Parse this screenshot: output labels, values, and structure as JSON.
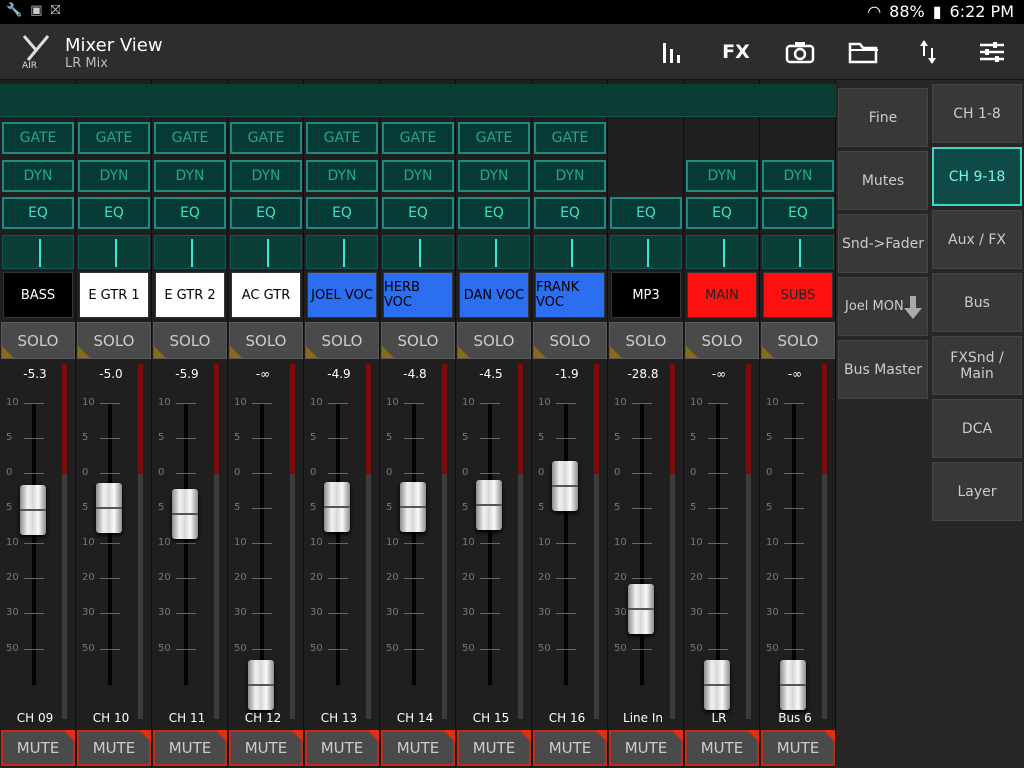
{
  "status": {
    "battery": "88%",
    "time": "6:22 PM"
  },
  "header": {
    "title": "Mixer View",
    "subtitle": "LR Mix",
    "logo_text": "AIR",
    "fx_label": "FX"
  },
  "buttons": {
    "gate": "GATE",
    "dyn": "DYN",
    "eq": "EQ",
    "solo": "SOLO",
    "mute": "MUTE"
  },
  "channels": [
    {
      "label": "BASS",
      "name": "CH 09",
      "gain": "-5.3",
      "color": "#000000",
      "text": "#ffffff",
      "gate": true,
      "dyn": true,
      "fader_db": -5.3
    },
    {
      "label": "E GTR 1",
      "name": "CH 10",
      "gain": "-5.0",
      "color": "#ffffff",
      "text": "#000000",
      "gate": true,
      "dyn": true,
      "fader_db": -5.0
    },
    {
      "label": "E GTR 2",
      "name": "CH 11",
      "gain": "-5.9",
      "color": "#ffffff",
      "text": "#000000",
      "gate": true,
      "dyn": true,
      "fader_db": -5.9
    },
    {
      "label": "AC GTR",
      "name": "CH 12",
      "gain": "-∞",
      "color": "#ffffff",
      "text": "#000000",
      "gate": true,
      "dyn": true,
      "fader_db": -90
    },
    {
      "label": "JOEL VOC",
      "name": "CH 13",
      "gain": "-4.9",
      "color": "#2b6ef0",
      "text": "#000000",
      "gate": true,
      "dyn": true,
      "fader_db": -4.9
    },
    {
      "label": "HERB VOC",
      "name": "CH 14",
      "gain": "-4.8",
      "color": "#2b6ef0",
      "text": "#000000",
      "gate": true,
      "dyn": true,
      "fader_db": -4.8
    },
    {
      "label": "DAN VOC",
      "name": "CH 15",
      "gain": "-4.5",
      "color": "#2b6ef0",
      "text": "#000000",
      "gate": true,
      "dyn": true,
      "fader_db": -4.5
    },
    {
      "label": "FRANK VOC",
      "name": "CH 16",
      "gain": "-1.9",
      "color": "#2b6ef0",
      "text": "#000000",
      "gate": true,
      "dyn": true,
      "fader_db": -1.9
    },
    {
      "label": "MP3",
      "name": "Line In",
      "gain": "-28.8",
      "color": "#000000",
      "text": "#ffffff",
      "gate": false,
      "dyn": false,
      "fader_db": -28.8
    },
    {
      "label": "MAIN",
      "name": "LR",
      "gain": "-∞",
      "color": "#ff1010",
      "text": "#222222",
      "gate": false,
      "dyn": true,
      "fader_db": -90
    },
    {
      "label": "SUBS",
      "name": "Bus 6",
      "gain": "-∞",
      "color": "#ff1010",
      "text": "#222222",
      "gate": false,
      "dyn": true,
      "fader_db": -90
    }
  ],
  "scale": [
    "10",
    "5",
    "0",
    "5",
    "10",
    "20",
    "30",
    "50"
  ],
  "side_left": [
    "Fine",
    "Mutes",
    "Snd->Fader",
    "Joel MON",
    "Bus Master"
  ],
  "side_right": [
    "CH 1-8",
    "CH 9-18",
    "Aux / FX",
    "Bus",
    "FXSnd / Main",
    "DCA",
    "Layer"
  ],
  "active_layer": "CH 9-18"
}
